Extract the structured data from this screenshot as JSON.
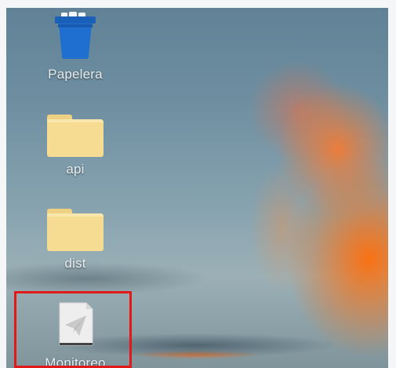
{
  "desktop": {
    "icons": [
      {
        "label": "Papelera",
        "icon": "trash-icon"
      },
      {
        "label": "api",
        "icon": "folder-icon"
      },
      {
        "label": "dist",
        "icon": "folder-icon"
      },
      {
        "label": "Monitoreo",
        "icon": "paper-plane-file-icon"
      }
    ],
    "highlight_color": "#e31919",
    "folder_color": "#f6dc92",
    "trash_color": "#1f6fd1"
  }
}
